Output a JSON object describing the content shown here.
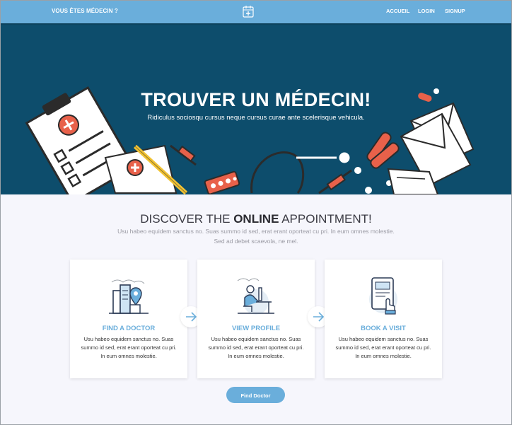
{
  "header": {
    "brand": "VOUS ÊTES MÉDECIN ?",
    "nav": [
      "ACCUEIL",
      "LOGIN",
      "SIGNUP"
    ],
    "logo_icon": "hospital-calendar-icon"
  },
  "hero": {
    "title": "TROUVER UN MÉDECIN!",
    "subtitle": "Ridiculus sociosqu cursus neque cursus curae ante scelerisque vehicula."
  },
  "discover": {
    "title_pre": "DISCOVER THE ",
    "title_bold": "ONLINE",
    "title_post": " APPOINTMENT!",
    "subtitle_line1": "Usu habeo equidem sanctus no. Suas summo id sed, erat erant oporteat cu pri. In eum omnes molestie.",
    "subtitle_line2": "Sed ad debet scaevola, ne mel."
  },
  "steps": [
    {
      "title": "FIND A DOCTOR",
      "text": "Usu habeo equidem sanctus no. Suas summo id sed, erat erant oporteat cu pri. In eum omnes molestie.",
      "icon": "city-location-pin-icon"
    },
    {
      "title": "VIEW PROFILE",
      "text": "Usu habeo equidem sanctus no. Suas summo id sed, erat erant oporteat cu pri. In eum omnes molestie.",
      "icon": "person-at-desk-icon"
    },
    {
      "title": "BOOK A VISIT",
      "text": "Usu habeo equidem sanctus no. Suas summo id sed, erat erant oporteat cu pri. In eum omnes molestie.",
      "icon": "tablet-touch-icon"
    }
  ],
  "cta": {
    "label": "Find Doctor"
  },
  "colors": {
    "primary": "#6aaedb",
    "hero_bg": "#0d4d6c",
    "accent_red": "#e8614a"
  }
}
